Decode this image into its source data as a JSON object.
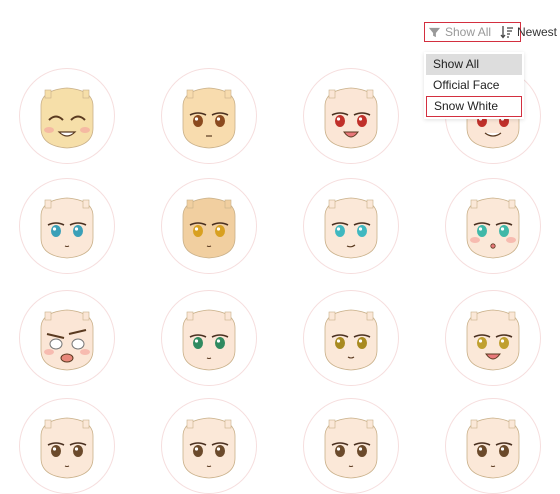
{
  "toolbar": {
    "filter_label": "Show All",
    "filter_icon": "filter-icon",
    "sort_label": "Newest",
    "sort_icon": "sort-icon"
  },
  "dropdown": {
    "options": [
      "Show All",
      "Official Face",
      "Snow White"
    ],
    "selected": "Show All",
    "highlighted": "Snow White"
  },
  "colors": {
    "accent": "#d32f3f",
    "circle_border": "#f6dede",
    "dropdown_selected_bg": "#dddddd"
  },
  "faces": [
    {
      "skin": "#f6dfa9",
      "eyes": "happy-closed",
      "eye_color": "#6b4a2b",
      "mouth": "grin",
      "blush": true
    },
    {
      "skin": "#f8dcae",
      "eyes": "open",
      "eye_color": "#8b4a1e",
      "mouth": "flat",
      "blush": false
    },
    {
      "skin": "#fbe6d6",
      "eyes": "wink",
      "eye_color": "#c0302a",
      "mouth": "open-smile",
      "blush": false
    },
    {
      "skin": "#fbe6d6",
      "eyes": "open",
      "eye_color": "#c0302a",
      "mouth": "toothy",
      "blush": false
    },
    {
      "skin": "#fbe8d8",
      "eyes": "open",
      "eye_color": "#3aa0b8",
      "mouth": "small",
      "blush": false
    },
    {
      "skin": "#f1cfa0",
      "eyes": "open",
      "eye_color": "#d8a020",
      "mouth": "small",
      "blush": false
    },
    {
      "skin": "#fbe8d8",
      "eyes": "open",
      "eye_color": "#40b8c0",
      "mouth": "smirk",
      "blush": false
    },
    {
      "skin": "#fbe8d8",
      "eyes": "open",
      "eye_color": "#40b8a8",
      "mouth": "o",
      "blush": true
    },
    {
      "skin": "#fbe6d6",
      "eyes": "angry",
      "eye_color": "#555555",
      "mouth": "shout",
      "blush": true
    },
    {
      "skin": "#fbe6d6",
      "eyes": "open",
      "eye_color": "#2f8a60",
      "mouth": "small",
      "blush": false
    },
    {
      "skin": "#fbe8d8",
      "eyes": "open",
      "eye_color": "#a88a20",
      "mouth": "small-smile",
      "blush": false
    },
    {
      "skin": "#fbe8d8",
      "eyes": "open",
      "eye_color": "#c0a030",
      "mouth": "open-smile",
      "blush": false
    },
    {
      "skin": "#fbe8d8",
      "eyes": "open",
      "eye_color": "#6b4a2b",
      "mouth": "small",
      "blush": false
    },
    {
      "skin": "#fbe8d8",
      "eyes": "open",
      "eye_color": "#6b4a2b",
      "mouth": "small",
      "blush": false
    },
    {
      "skin": "#fbe8d8",
      "eyes": "open",
      "eye_color": "#6b4a2b",
      "mouth": "small",
      "blush": false
    },
    {
      "skin": "#fbe8d8",
      "eyes": "open",
      "eye_color": "#6b4a2b",
      "mouth": "small",
      "blush": false
    }
  ]
}
